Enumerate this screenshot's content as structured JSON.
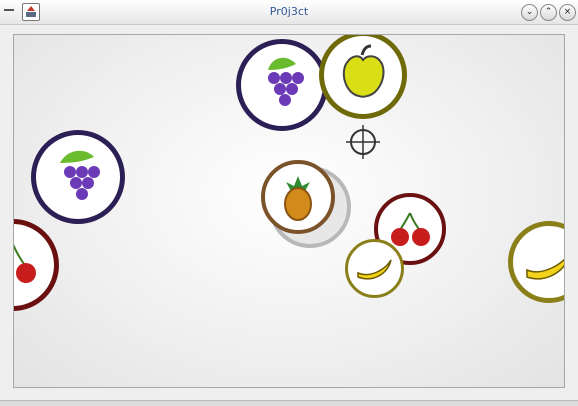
{
  "window": {
    "title": "Pr0j3ct"
  },
  "titlebar": {
    "app_icon": "app-icon",
    "menu_icon": "window-menu-icon",
    "minimize_icon": "chevron-down-icon",
    "maximize_icon": "chevron-up-icon",
    "close_icon": "close-icon"
  },
  "game": {
    "cursor": "crosshair-icon",
    "fruits": [
      {
        "kind": "grape",
        "color": "#2c1f55"
      },
      {
        "kind": "apple",
        "color": "#6f6a09"
      },
      {
        "kind": "grape",
        "color": "#2c1f55"
      },
      {
        "kind": "pineapple",
        "color": "#7a5328"
      },
      {
        "kind": "cherry",
        "color": "#6a1010"
      },
      {
        "kind": "banana",
        "color": "#8b7f1a"
      },
      {
        "kind": "banana",
        "color": "#8b7f1a"
      },
      {
        "kind": "cherry",
        "color": "#6a1010"
      }
    ]
  }
}
